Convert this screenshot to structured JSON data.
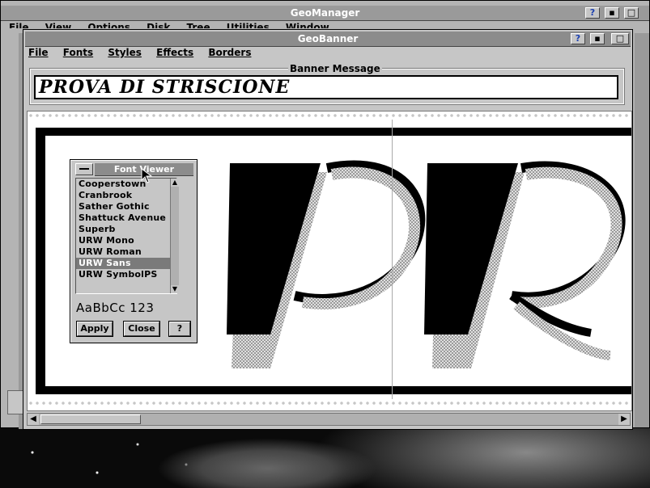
{
  "manager": {
    "title": "GeoManager",
    "menu": [
      "File",
      "View",
      "Options",
      "Disk",
      "Tree",
      "Utilities",
      "Window"
    ]
  },
  "banner": {
    "title": "GeoBanner",
    "menu": [
      "File",
      "Fonts",
      "Styles",
      "Effects",
      "Borders"
    ],
    "group_label": "Banner Message",
    "message": "PROVA DI STRISCIONE",
    "preview_letters": [
      "P",
      "R"
    ]
  },
  "font_viewer": {
    "title": "Font Viewer",
    "fonts": [
      "Cooperstown",
      "Cranbrook",
      "Sather Gothic",
      "Shattuck Avenue",
      "Superb",
      "URW Mono",
      "URW Roman",
      "URW Sans",
      "URW SymbolPS"
    ],
    "selected_index": 7,
    "sample": "AaBbCc 123",
    "apply_label": "Apply",
    "close_label": "Close",
    "help_label": "?"
  },
  "buttons": {
    "help": "?"
  },
  "colors": {
    "title_bar": "#8c8c8c",
    "chrome": "#c6c6c6",
    "selection": "#7a7a7a"
  }
}
